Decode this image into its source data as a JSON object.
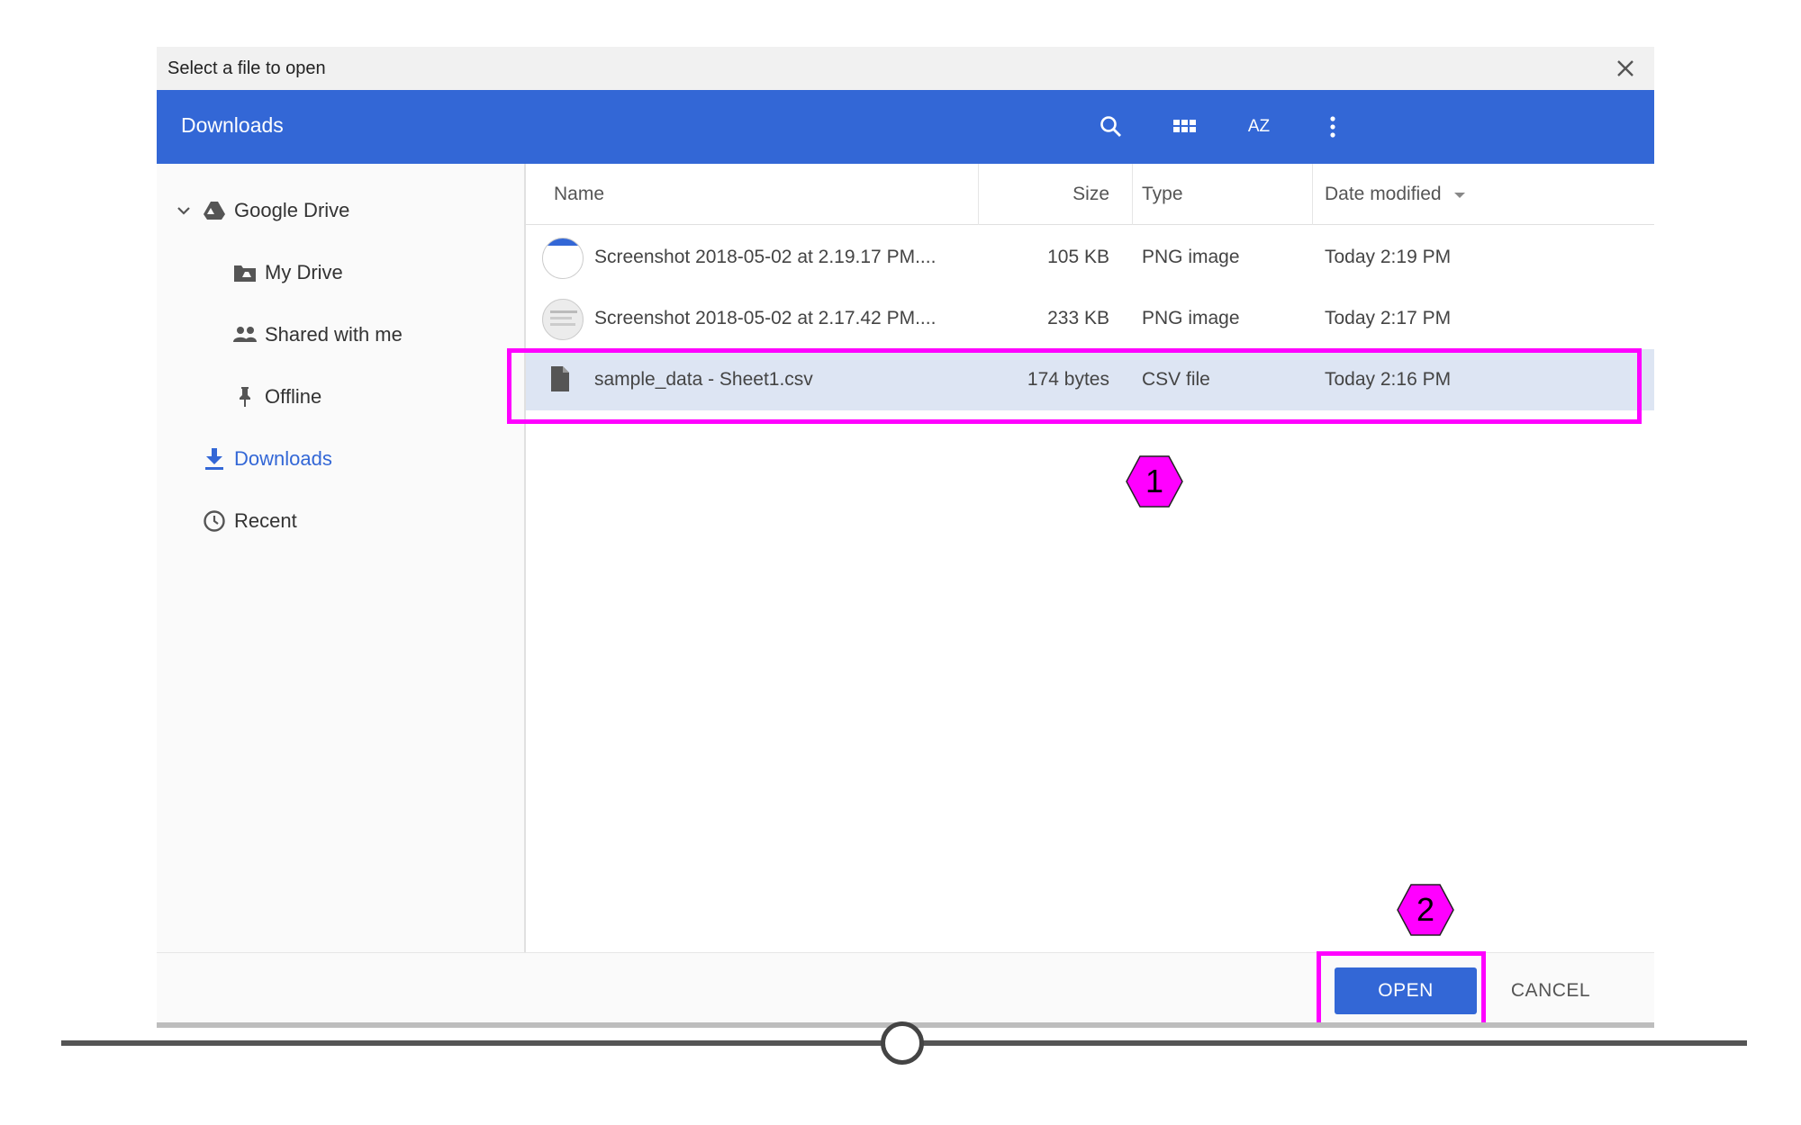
{
  "dialog": {
    "title": "Select a file to open",
    "location": "Downloads"
  },
  "toolbar": {
    "icons": [
      "search-icon",
      "grid-view-icon",
      "sort-az-icon",
      "more-vert-icon"
    ],
    "sort_label": "AZ"
  },
  "sidebar": {
    "items": [
      {
        "label": "Google Drive",
        "icon": "google-drive-icon",
        "expanded": true
      },
      {
        "label": "My Drive",
        "icon": "my-drive-folder-icon"
      },
      {
        "label": "Shared with me",
        "icon": "people-icon"
      },
      {
        "label": "Offline",
        "icon": "pin-icon"
      },
      {
        "label": "Downloads",
        "icon": "download-icon",
        "active": true
      },
      {
        "label": "Recent",
        "icon": "clock-icon"
      }
    ]
  },
  "columns": {
    "name": "Name",
    "size": "Size",
    "type": "Type",
    "date": "Date modified"
  },
  "files": [
    {
      "name": "Screenshot 2018-05-02 at 2.19.17 PM....",
      "size": "105 KB",
      "type": "PNG image",
      "date": "Today 2:19 PM"
    },
    {
      "name": "Screenshot 2018-05-02 at 2.17.42 PM....",
      "size": "233 KB",
      "type": "PNG image",
      "date": "Today 2:17 PM"
    },
    {
      "name": "sample_data - Sheet1.csv",
      "size": "174 bytes",
      "type": "CSV file",
      "date": "Today 2:16 PM",
      "selected": true
    }
  ],
  "footer": {
    "open_label": "OPEN",
    "cancel_label": "CANCEL"
  },
  "annotations": {
    "step1": "1",
    "step2": "2",
    "highlight_color": "#ff00ff"
  },
  "colors": {
    "accent": "#3367d6",
    "selected_row": "#dde5f3"
  }
}
